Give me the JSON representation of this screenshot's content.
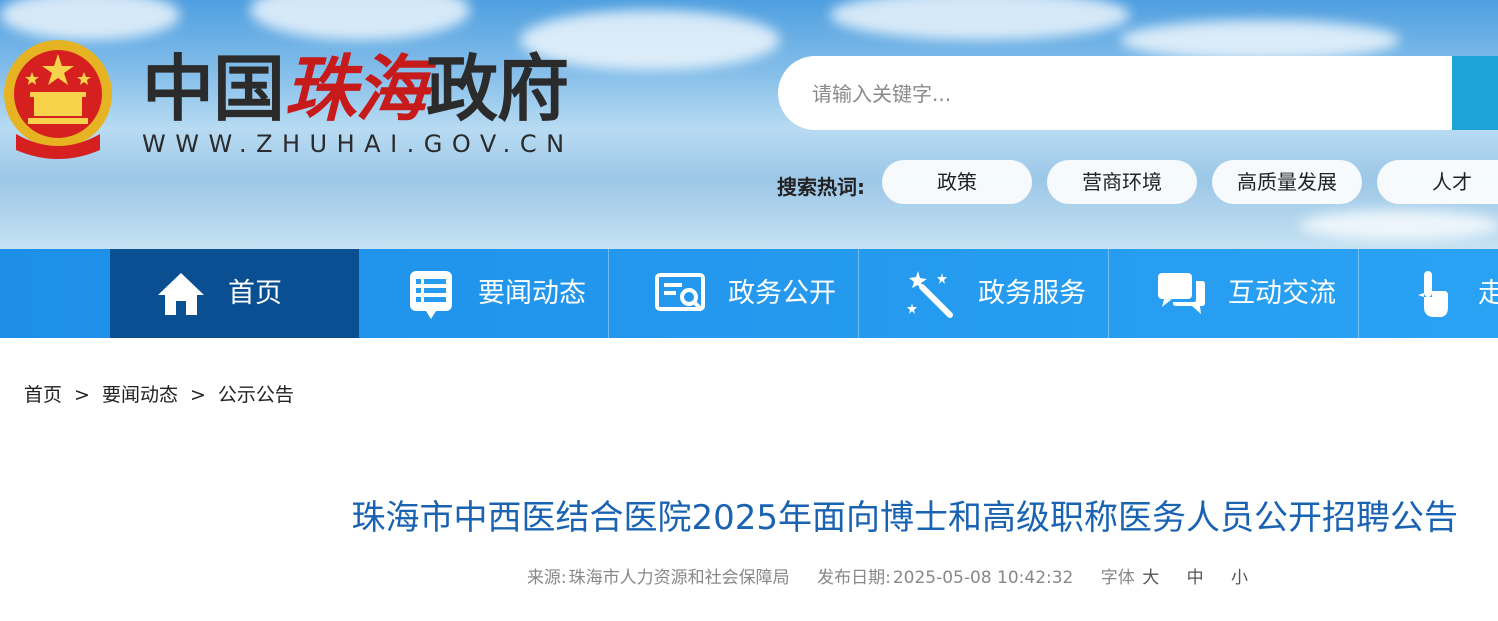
{
  "header": {
    "site_name_part1": "中国",
    "site_name_part2": "珠海",
    "site_name_part3": "政府",
    "site_url": "WWW.ZHUHAI.GOV.CN",
    "emblem_icon": "national-emblem-icon"
  },
  "search": {
    "placeholder": "请输入关键字...",
    "button_color": "#1ea3d6"
  },
  "hot_search": {
    "label": "搜索热词:",
    "tags": [
      "政策",
      "营商环境",
      "高质量发展",
      "人才"
    ]
  },
  "nav": {
    "items": [
      {
        "label": "首页",
        "icon": "home-icon",
        "active": true
      },
      {
        "label": "要闻动态",
        "icon": "news-list-icon",
        "active": false
      },
      {
        "label": "政务公开",
        "icon": "document-search-icon",
        "active": false
      },
      {
        "label": "政务服务",
        "icon": "magic-wand-icon",
        "active": false
      },
      {
        "label": "互动交流",
        "icon": "chat-bubbles-icon",
        "active": false
      },
      {
        "label": "走",
        "icon": "tap-hand-icon",
        "active": false
      }
    ],
    "active_color": "#0b4f93",
    "bar_color": "#2aa2f4"
  },
  "breadcrumb": {
    "items": [
      "首页",
      "要闻动态",
      "公示公告"
    ],
    "separator": ">"
  },
  "article": {
    "title": "珠海市中西医结合医院2025年面向博士和高级职称医务人员公开招聘公告",
    "source_label": "来源:",
    "source": "珠海市人力资源和社会保障局",
    "date_label": "发布日期:",
    "date": "2025-05-08 10:42:32",
    "font_label": "字体",
    "font_large": "大",
    "font_medium": "中",
    "font_small": "小",
    "title_color": "#1a63b3"
  }
}
